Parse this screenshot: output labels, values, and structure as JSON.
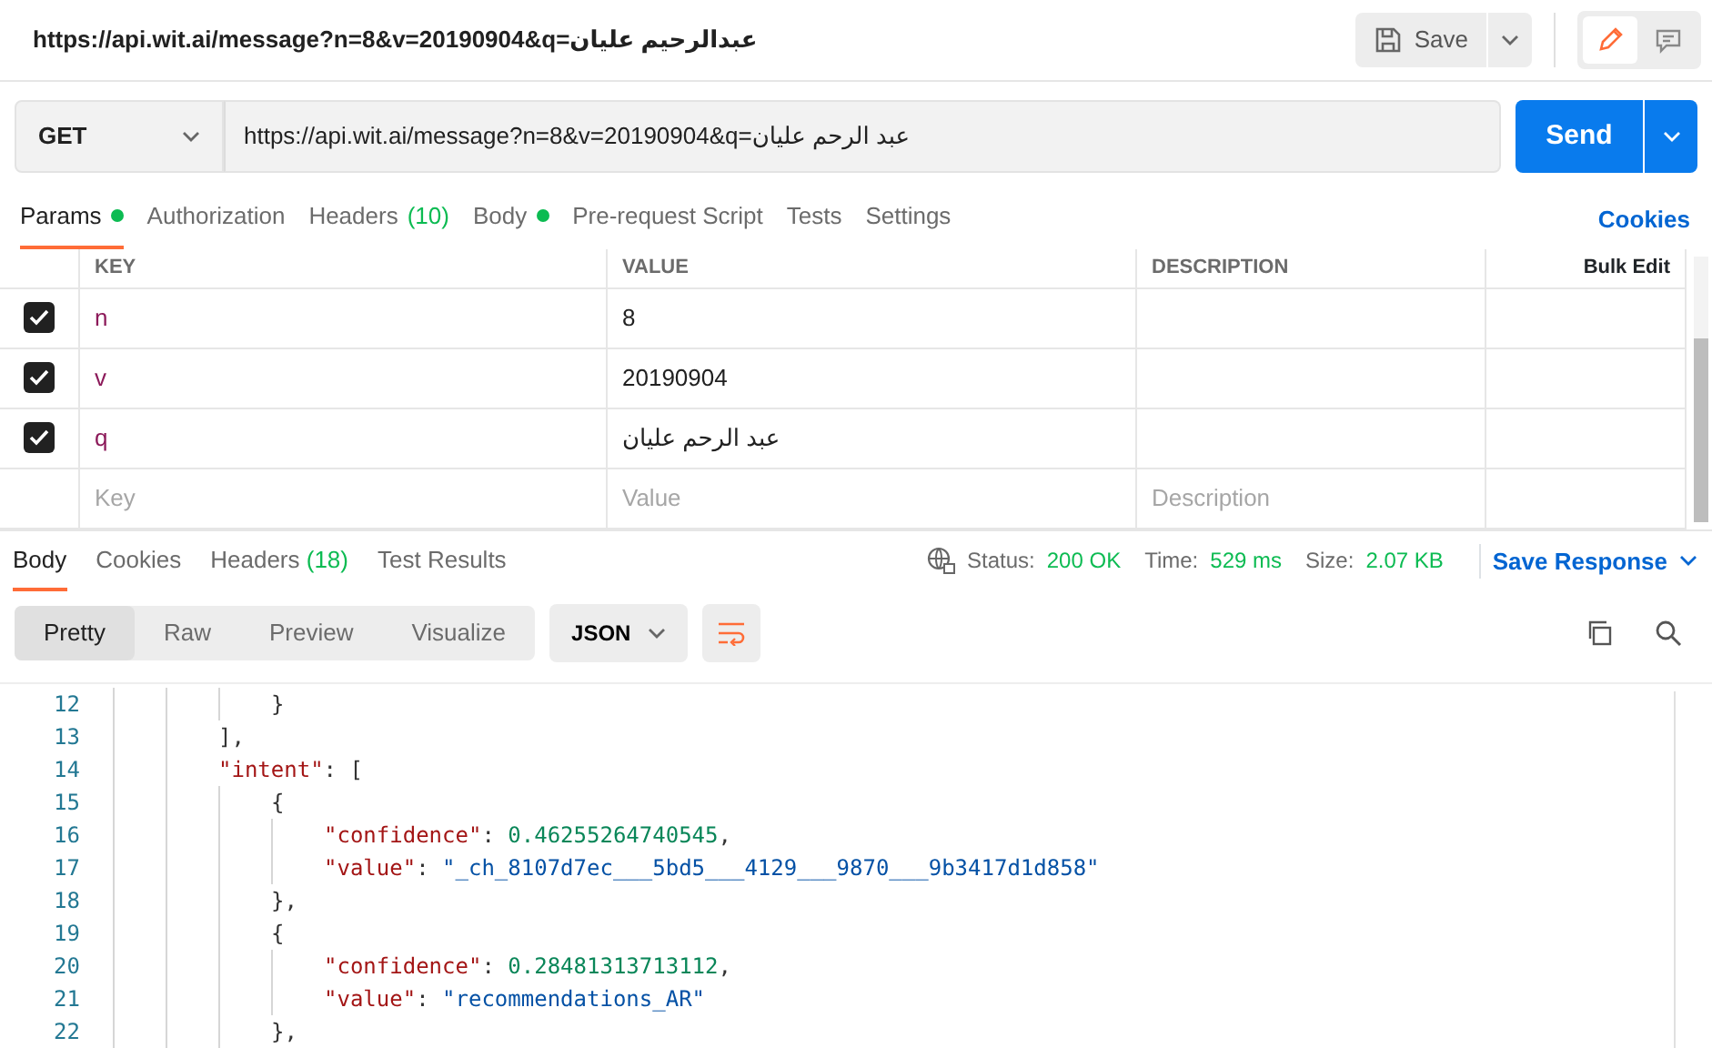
{
  "title": "https://api.wit.ai/message?n=8&v=20190904&q=عبدالرحيم عليان",
  "save": {
    "label": "Save"
  },
  "mode_toggle": [
    {
      "kind": "edit",
      "selected": true
    },
    {
      "kind": "comment",
      "selected": false
    }
  ],
  "request": {
    "method": "GET",
    "url": "https://api.wit.ai/message?n=8&v=20190904&q=عبد الرحم عليان",
    "send": "Send"
  },
  "request_tabs": [
    {
      "label": "Params",
      "dot": true,
      "selected": true
    },
    {
      "label": "Authorization",
      "dot": false,
      "selected": false
    },
    {
      "label": "Headers",
      "count": "(10)",
      "dot": false,
      "selected": false
    },
    {
      "label": "Body",
      "dot": true,
      "selected": false
    },
    {
      "label": "Pre-request Script",
      "dot": false,
      "selected": false
    },
    {
      "label": "Tests",
      "dot": false,
      "selected": false
    },
    {
      "label": "Settings",
      "dot": false,
      "selected": false
    }
  ],
  "cookies_link": "Cookies",
  "params": {
    "columns": [
      "KEY",
      "VALUE",
      "DESCRIPTION"
    ],
    "bulk_edit": "Bulk Edit",
    "rows": [
      {
        "checked": true,
        "key": "n",
        "value": "8"
      },
      {
        "checked": true,
        "key": "v",
        "value": "20190904"
      },
      {
        "checked": true,
        "key": "q",
        "value": "عبد الرحم عليان"
      }
    ],
    "new_row": {
      "key": "Key",
      "value": "Value",
      "description": "Description"
    }
  },
  "response_tabs": [
    {
      "label": "Body",
      "selected": true
    },
    {
      "label": "Cookies",
      "selected": false
    },
    {
      "label": "Headers",
      "count": "(18)",
      "selected": false
    },
    {
      "label": "Test Results",
      "selected": false
    }
  ],
  "status": [
    {
      "label": "Status:",
      "value": "200 OK"
    },
    {
      "label": "Time:",
      "value": "529 ms"
    },
    {
      "label": "Size:",
      "value": "2.07 KB"
    }
  ],
  "save_response": "Save Response",
  "view_modes": [
    {
      "label": "Pretty",
      "selected": true
    },
    {
      "label": "Raw",
      "selected": false
    },
    {
      "label": "Preview",
      "selected": false
    },
    {
      "label": "Visualize",
      "selected": false
    }
  ],
  "format": "JSON",
  "code_lines": [
    {
      "children": [
        {
          "number": "12",
          "tokens": [
            {
              "kind": "punct",
              "text": "}"
            }
          ]
        }
      ]
    },
    {
      "number": "13",
      "tokens": [
        {
          "kind": "punct",
          "text": "],"
        }
      ]
    },
    {
      "number": "14",
      "tokens": [
        {
          "kind": "key",
          "text": "\"intent\""
        },
        {
          "kind": "punct",
          "text": ": ["
        }
      ],
      "children": [
        {
          "number": "15",
          "tokens": [
            {
              "kind": "punct",
              "text": "{"
            }
          ],
          "children": [
            {
              "number": "16",
              "tokens": [
                {
                  "kind": "key",
                  "text": "\"confidence\""
                },
                {
                  "kind": "punct",
                  "text": ": "
                },
                {
                  "kind": "number",
                  "text": "0.46255264740545"
                },
                {
                  "kind": "punct",
                  "text": ","
                }
              ]
            },
            {
              "number": "17",
              "tokens": [
                {
                  "kind": "key",
                  "text": "\"value\""
                },
                {
                  "kind": "punct",
                  "text": ": "
                },
                {
                  "kind": "string",
                  "text": "\"_ch_8107d7ec___5bd5___4129___9870___9b3417d1d858\""
                }
              ]
            }
          ]
        },
        {
          "number": "18",
          "tokens": [
            {
              "kind": "punct",
              "text": "},"
            }
          ]
        },
        {
          "number": "19",
          "tokens": [
            {
              "kind": "punct",
              "text": "{"
            }
          ],
          "children": [
            {
              "number": "20",
              "tokens": [
                {
                  "kind": "key",
                  "text": "\"confidence\""
                },
                {
                  "kind": "punct",
                  "text": ": "
                },
                {
                  "kind": "number",
                  "text": "0.28481313713112"
                },
                {
                  "kind": "punct",
                  "text": ","
                }
              ]
            },
            {
              "number": "21",
              "tokens": [
                {
                  "kind": "key",
                  "text": "\"value\""
                },
                {
                  "kind": "punct",
                  "text": ": "
                },
                {
                  "kind": "string",
                  "text": "\"recommendations_AR\""
                }
              ]
            }
          ]
        },
        {
          "number": "22",
          "tokens": [
            {
              "kind": "punct",
              "text": "},"
            }
          ]
        }
      ]
    }
  ]
}
